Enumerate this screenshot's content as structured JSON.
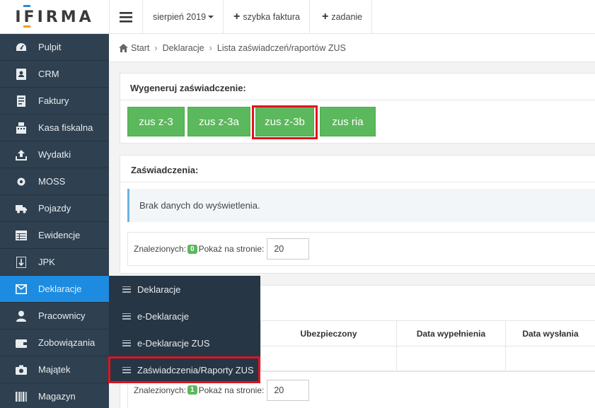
{
  "header": {
    "logo": "IFIRMA",
    "period": "sierpień 2019",
    "quick_invoice": "szybka faktura",
    "task": "zadanie"
  },
  "sidebar": {
    "items": [
      {
        "label": "Pulpit",
        "icon": "dashboard-icon"
      },
      {
        "label": "CRM",
        "icon": "contact-card-icon"
      },
      {
        "label": "Faktury",
        "icon": "invoice-icon"
      },
      {
        "label": "Kasa fiskalna",
        "icon": "cash-register-icon"
      },
      {
        "label": "Wydatki",
        "icon": "upload-icon"
      },
      {
        "label": "MOSS",
        "icon": "moss-icon"
      },
      {
        "label": "Pojazdy",
        "icon": "truck-icon"
      },
      {
        "label": "Ewidencje",
        "icon": "table-icon"
      },
      {
        "label": "JPK",
        "icon": "jpk-icon"
      },
      {
        "label": "Deklaracje",
        "icon": "envelope-icon"
      },
      {
        "label": "Pracownicy",
        "icon": "user-icon"
      },
      {
        "label": "Zobowiązania",
        "icon": "wallet-icon"
      },
      {
        "label": "Majątek",
        "icon": "camera-icon"
      },
      {
        "label": "Magazyn",
        "icon": "barcode-icon"
      }
    ]
  },
  "breadcrumb": {
    "start": "Start",
    "level1": "Deklaracje",
    "level2": "Lista zaświadczeń/raportów ZUS"
  },
  "generate": {
    "title": "Wygeneruj zaświadczenie:",
    "buttons": [
      "zus z-3",
      "zus z-3a",
      "zus z-3b",
      "zus ria"
    ]
  },
  "certificates": {
    "title": "Zaświadczenia:",
    "empty": "Brak danych do wyświetlenia.",
    "found_label": "Znalezionych:",
    "found_count": "0",
    "per_page_label": "Pokaż na stronie:",
    "per_page": "20"
  },
  "reports": {
    "columns": [
      "Ubezpieczony",
      "Data wypełnienia",
      "Data wysłania"
    ],
    "found_label": "Znalezionych:",
    "found_count": "1",
    "per_page_label": "Pokaż na stronie:",
    "per_page": "20"
  },
  "submenu": {
    "items": [
      "Deklaracje",
      "e-Deklaracje",
      "e-Deklaracje ZUS",
      "Zaświadczenia/Raporty ZUS"
    ]
  },
  "colors": {
    "sidebar": "#2f4050",
    "active": "#1d8ce0",
    "button": "#5cb85c",
    "highlight": "#e0131e"
  }
}
